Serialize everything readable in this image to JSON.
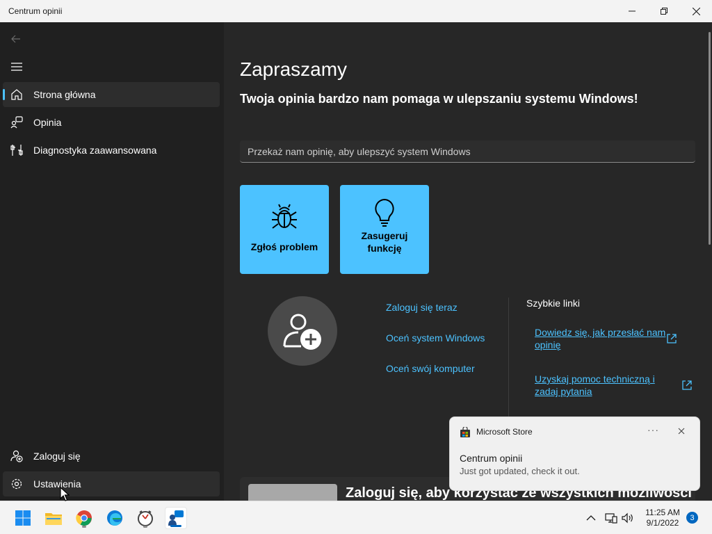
{
  "window": {
    "title": "Centrum opinii"
  },
  "nav": {
    "items": [
      {
        "label": "Strona główna",
        "icon": "home-icon",
        "selected": true
      },
      {
        "label": "Opinia",
        "icon": "feedback-icon"
      },
      {
        "label": "Diagnostyka zaawansowana",
        "icon": "diagnostics-icon"
      }
    ],
    "bottom_items": [
      {
        "label": "Zaloguj się",
        "icon": "sign-in-icon"
      },
      {
        "label": "Ustawienia",
        "icon": "gear-icon"
      }
    ]
  },
  "main": {
    "title": "Zapraszamy",
    "subtitle": "Twoja opinia bardzo nam pomaga w ulepszaniu systemu Windows!",
    "search_placeholder": "Przekaż nam opinię, aby ulepszyć system Windows",
    "tiles": [
      {
        "label": "Zgłoś problem",
        "icon": "bug-icon"
      },
      {
        "label": "Zasugeruj funkcję",
        "icon": "lightbulb-icon"
      }
    ],
    "links": [
      "Zaloguj się teraz",
      "Oceń system Windows",
      "Oceń swój komputer"
    ],
    "quick_links": {
      "title": "Szybkie linki",
      "items": [
        "Dowiedz się, jak przesłać nam opinię",
        "Uzyskaj pomoc techniczną i zadaj pytania"
      ]
    },
    "signin_card_title": "Zaloguj się, aby korzystać ze wszystkich możliwości"
  },
  "toast": {
    "app": "Microsoft Store",
    "more": "···",
    "title": "Centrum opinii",
    "body": "Just got updated, check it out."
  },
  "taskbar": {
    "apps": [
      "start-icon",
      "file-explorer-icon",
      "chrome-icon",
      "edge-icon",
      "clock-app-icon",
      "feedback-hub-icon"
    ],
    "time": "11:25 AM",
    "date": "9/1/2022",
    "notification_count": "3"
  },
  "colors": {
    "accent": "#4cc2ff",
    "background": "#202020",
    "content": "#272727"
  }
}
